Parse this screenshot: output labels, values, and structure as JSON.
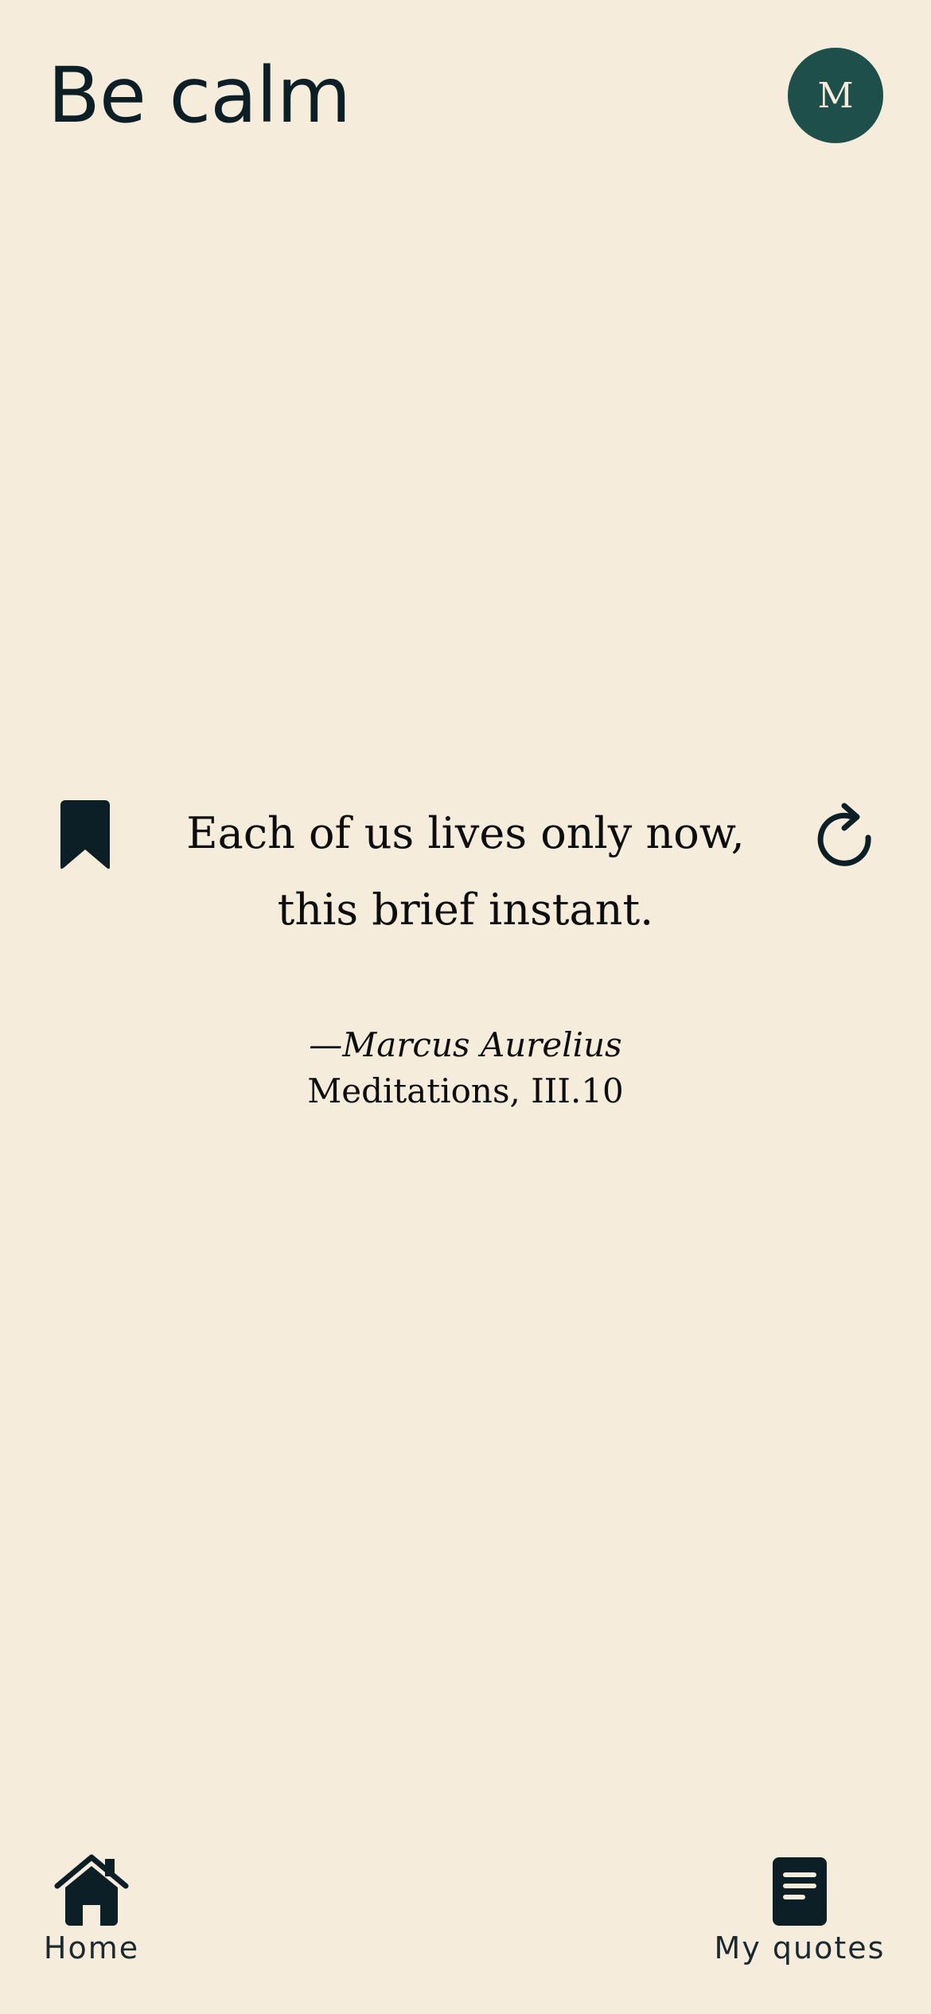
{
  "header": {
    "title": "Be calm",
    "avatar_initial": "M"
  },
  "quote": {
    "text": "Each of us lives only now, this brief instant.",
    "author": "—Marcus Aurelius",
    "source": "Meditations, III.10"
  },
  "actions": {
    "bookmark_icon": "bookmark-icon",
    "refresh_icon": "refresh-icon"
  },
  "nav": {
    "home_label": "Home",
    "home_icon": "home-icon",
    "quotes_label": "My quotes",
    "quotes_icon": "document-icon"
  },
  "colors": {
    "background": "#f5ecdc",
    "text": "#0d1f26",
    "avatar_bg": "#1f4f4b"
  }
}
